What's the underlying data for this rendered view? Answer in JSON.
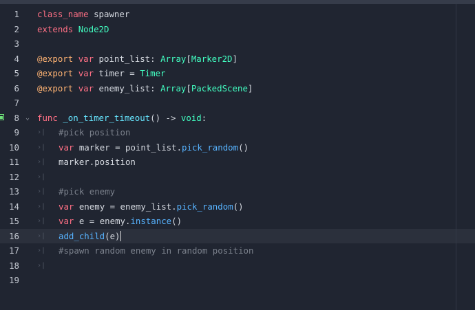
{
  "editor": {
    "lines": [
      {
        "n": "1",
        "tokens": [
          {
            "t": "class_name",
            "c": "kw"
          },
          {
            "t": " spawner",
            "c": "tx"
          }
        ]
      },
      {
        "n": "2",
        "tokens": [
          {
            "t": "extends",
            "c": "kw"
          },
          {
            "t": " ",
            "c": "tx"
          },
          {
            "t": "Node2D",
            "c": "ty"
          }
        ]
      },
      {
        "n": "3",
        "tokens": []
      },
      {
        "n": "4",
        "tokens": [
          {
            "t": "@export",
            "c": "an"
          },
          {
            "t": " ",
            "c": "tx"
          },
          {
            "t": "var",
            "c": "kw"
          },
          {
            "t": " point_list: ",
            "c": "tx"
          },
          {
            "t": "Array",
            "c": "ty"
          },
          {
            "t": "[",
            "c": "tx"
          },
          {
            "t": "Marker2D",
            "c": "ty"
          },
          {
            "t": "]",
            "c": "tx"
          }
        ]
      },
      {
        "n": "5",
        "tokens": [
          {
            "t": "@export",
            "c": "an"
          },
          {
            "t": " ",
            "c": "tx"
          },
          {
            "t": "var",
            "c": "kw"
          },
          {
            "t": " timer = ",
            "c": "tx"
          },
          {
            "t": "Timer",
            "c": "ty"
          }
        ]
      },
      {
        "n": "6",
        "tokens": [
          {
            "t": "@export",
            "c": "an"
          },
          {
            "t": " ",
            "c": "tx"
          },
          {
            "t": "var",
            "c": "kw"
          },
          {
            "t": " enemy_list: ",
            "c": "tx"
          },
          {
            "t": "Array",
            "c": "ty"
          },
          {
            "t": "[",
            "c": "tx"
          },
          {
            "t": "PackedScene",
            "c": "ty"
          },
          {
            "t": "]",
            "c": "tx"
          }
        ]
      },
      {
        "n": "7",
        "tokens": []
      },
      {
        "n": "8",
        "tokens": [
          {
            "t": "func",
            "c": "kw"
          },
          {
            "t": " ",
            "c": "tx"
          },
          {
            "t": "_on_timer_timeout",
            "c": "fn"
          },
          {
            "t": "() -> ",
            "c": "tx"
          },
          {
            "t": "void",
            "c": "ty"
          },
          {
            "t": ":",
            "c": "tx"
          }
        ]
      },
      {
        "n": "9",
        "tokens": [
          {
            "t": "#pick position",
            "c": "cm"
          }
        ]
      },
      {
        "n": "10",
        "tokens": [
          {
            "t": "var",
            "c": "kw"
          },
          {
            "t": " marker = point_list.",
            "c": "tx"
          },
          {
            "t": "pick_random",
            "c": "mt"
          },
          {
            "t": "()",
            "c": "tx"
          }
        ]
      },
      {
        "n": "11",
        "tokens": [
          {
            "t": "marker.position",
            "c": "tx"
          }
        ]
      },
      {
        "n": "12",
        "tokens": []
      },
      {
        "n": "13",
        "tokens": [
          {
            "t": "#pick enemy",
            "c": "cm"
          }
        ]
      },
      {
        "n": "14",
        "tokens": [
          {
            "t": "var",
            "c": "kw"
          },
          {
            "t": " enemy = enemy_list.",
            "c": "tx"
          },
          {
            "t": "pick_random",
            "c": "mt"
          },
          {
            "t": "()",
            "c": "tx"
          }
        ]
      },
      {
        "n": "15",
        "tokens": [
          {
            "t": "var",
            "c": "kw"
          },
          {
            "t": " e = enemy.",
            "c": "tx"
          },
          {
            "t": "instance",
            "c": "mt"
          },
          {
            "t": "()",
            "c": "tx"
          }
        ]
      },
      {
        "n": "16",
        "tokens": [
          {
            "t": "add_child",
            "c": "mt"
          },
          {
            "t": "(e)",
            "c": "tx"
          }
        ]
      },
      {
        "n": "17",
        "tokens": [
          {
            "t": "#spawn random enemy in random position",
            "c": "cm"
          }
        ]
      },
      {
        "n": "18",
        "tokens": []
      },
      {
        "n": "19",
        "tokens": []
      }
    ],
    "indent_marker": "›|",
    "fold_marker": "⌄"
  },
  "colors": {
    "background": "#202531",
    "current_line": "#2b303c",
    "keyword": "#ff7085",
    "type": "#42ffc2",
    "function": "#66e6ff",
    "method": "#57b3ff",
    "annotation": "#ffb373",
    "comment": "#7b818c",
    "text": "#d5d9e0",
    "breakpoint_connection": "#6ee07a"
  }
}
